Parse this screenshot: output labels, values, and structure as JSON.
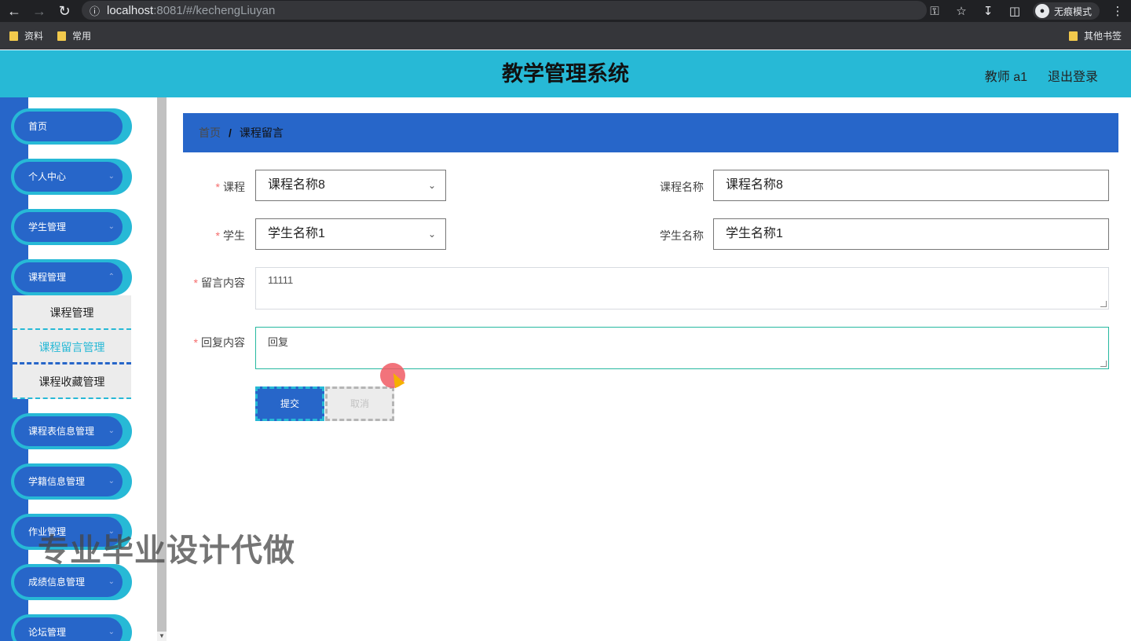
{
  "browser": {
    "url_host": "localhost",
    "url_path": ":8081/#/kechengLiuyan",
    "incognito_label": "无痕模式",
    "bookmarks": [
      "资料",
      "常用"
    ],
    "other_bookmarks": "其他书签"
  },
  "header": {
    "title": "教学管理系统",
    "user": "教师 a1",
    "logout": "退出登录"
  },
  "sidebar": {
    "items": [
      {
        "label": "首页"
      },
      {
        "label": "个人中心"
      },
      {
        "label": "学生管理"
      },
      {
        "label": "课程管理"
      },
      {
        "label": "课程表信息管理"
      },
      {
        "label": "学籍信息管理"
      },
      {
        "label": "作业管理"
      },
      {
        "label": "成绩信息管理"
      },
      {
        "label": "论坛管理"
      }
    ],
    "submenu": [
      {
        "label": "课程管理"
      },
      {
        "label": "课程留言管理"
      },
      {
        "label": "课程收藏管理"
      }
    ]
  },
  "breadcrumb": {
    "home": "首页",
    "separator": "/",
    "current": "课程留言"
  },
  "form": {
    "course_label": "课程",
    "course_value": "课程名称8",
    "course_name_label": "课程名称",
    "course_name_value": "课程名称8",
    "student_label": "学生",
    "student_value": "学生名称1",
    "student_name_label": "学生名称",
    "student_name_value": "学生名称1",
    "message_label": "留言内容",
    "message_value": "11111",
    "reply_label": "回复内容",
    "reply_value": "回复",
    "submit": "提交",
    "cancel": "取消"
  },
  "watermark": "专业毕业设计代做",
  "colors": {
    "header_bg": "#27b9d6",
    "sidebar_blue": "#2766c9",
    "breadcrumb_bg": "#2766c9",
    "required_star": "#f56c6c"
  }
}
